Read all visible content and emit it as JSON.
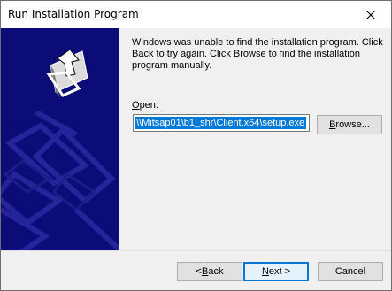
{
  "window": {
    "title": "Run Installation Program"
  },
  "message": "Windows was unable to find the installation program.  Click Back to try again.  Click Browse to find the installation program manually.",
  "open": {
    "label": "Open:",
    "value": "\\\\Mitsap01\\b1_shr\\Client.x64\\setup.exe"
  },
  "buttons": {
    "browse": "Browse...",
    "back": "< Back",
    "next": "Next >",
    "cancel": "Cancel"
  },
  "colors": {
    "banner": "#0c0c78",
    "selection": "#0078d7",
    "default_button_border": "#0078d7"
  },
  "icons": [
    "close-icon",
    "setup-wizard-icon"
  ]
}
